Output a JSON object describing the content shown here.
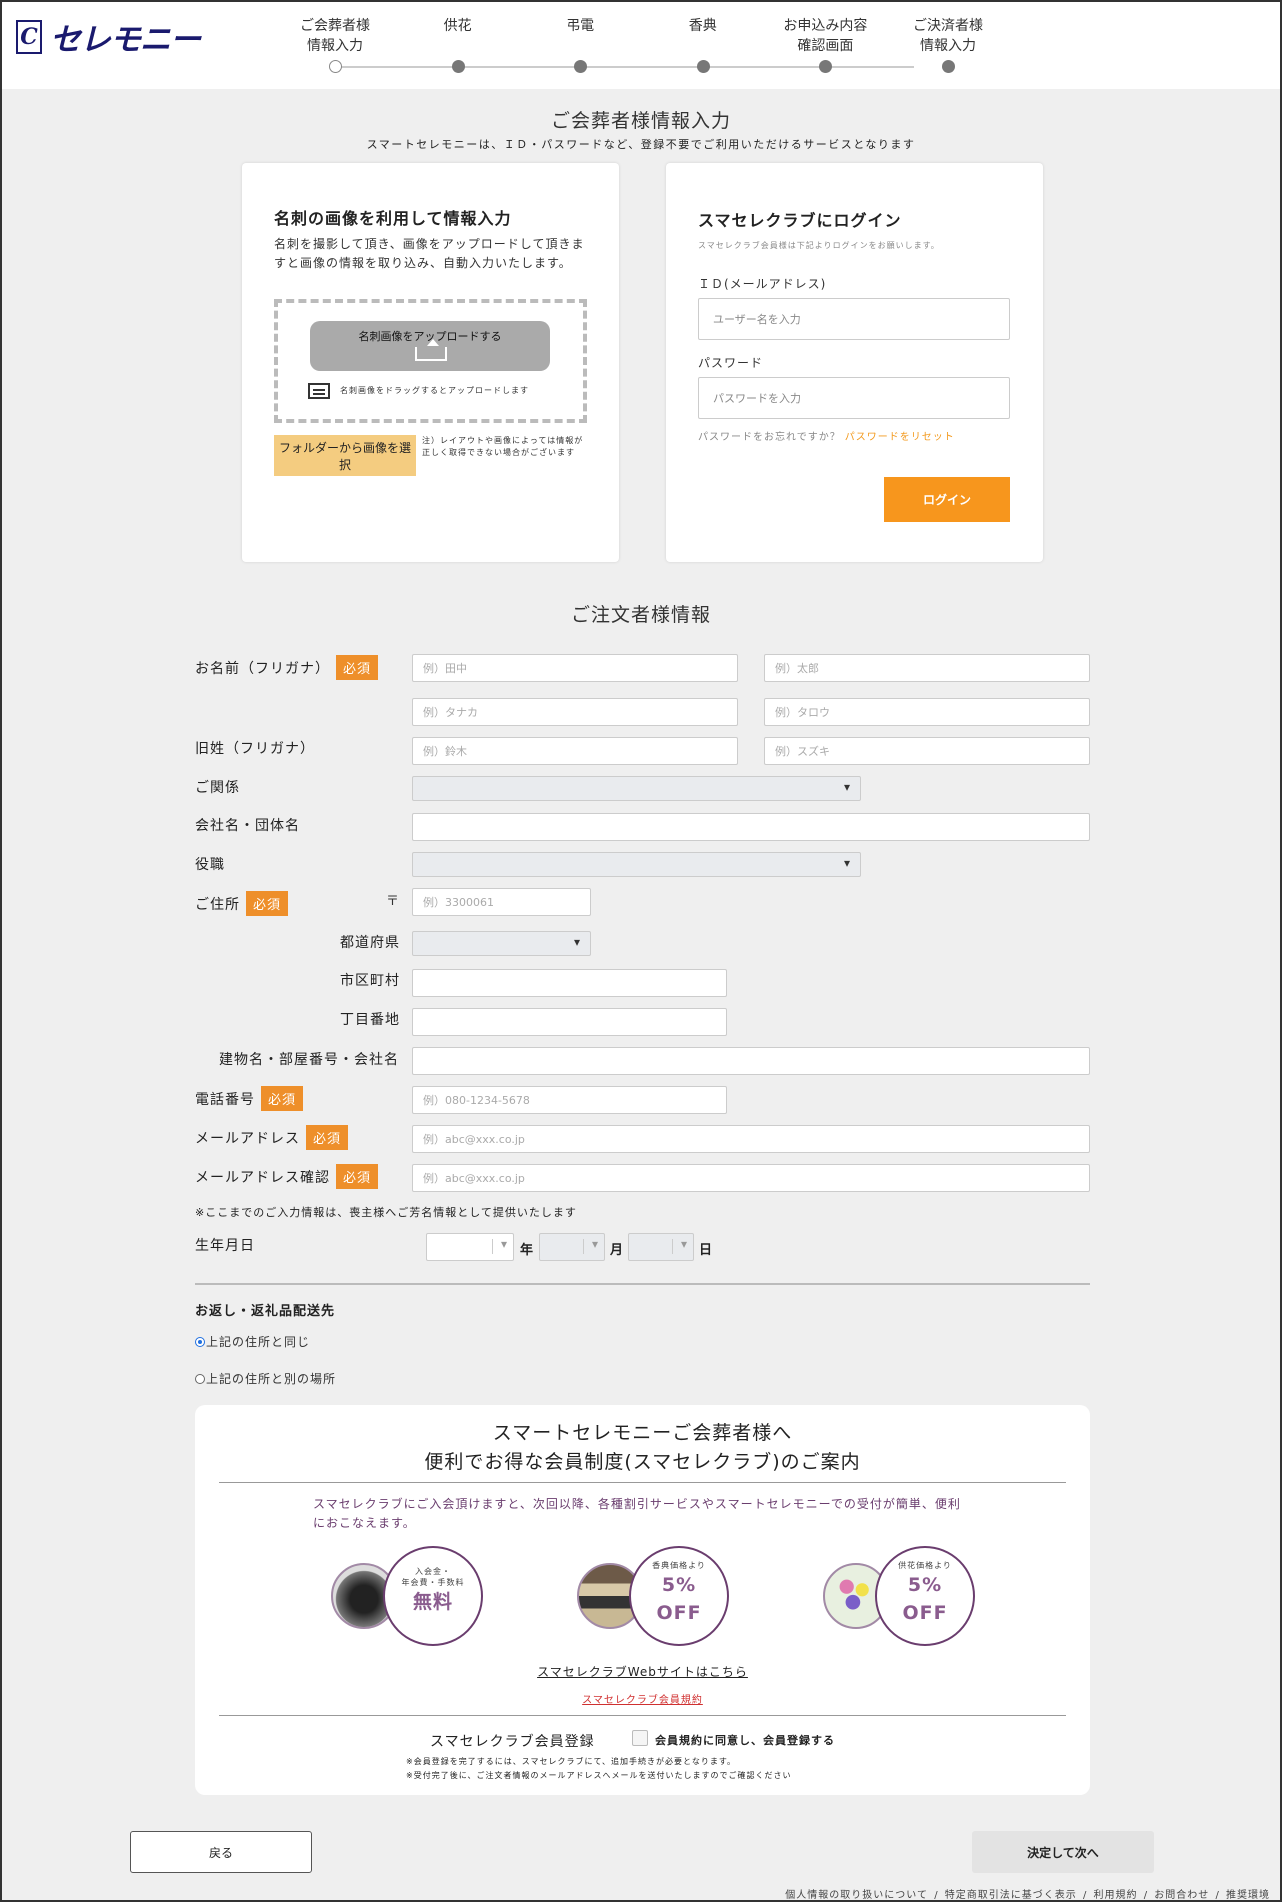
{
  "brand": {
    "logo_mark": "C",
    "logo_text": "セレモニー"
  },
  "steps": [
    {
      "label": "ご会葬者様\n情報入力",
      "current": true
    },
    {
      "label": "供花",
      "current": false
    },
    {
      "label": "弔電",
      "current": false
    },
    {
      "label": "香典",
      "current": false
    },
    {
      "label": "お申込み内容\n確認画面",
      "current": false
    },
    {
      "label": "ご決済者様\n情報入力",
      "current": false
    }
  ],
  "page": {
    "title": "ご会葬者様情報入力",
    "subtitle": "スマートセレモニーは、ＩＤ・パスワードなど、登録不要でご利用いただけるサービスとなります"
  },
  "card_upload": {
    "title": "名刺の画像を利用して情報入力",
    "description": "名刺を撮影して頂き、画像をアップロードして頂きますと画像の情報を取り込み、自動入力いたします。",
    "upload_button": "名刺画像をアップロードする",
    "drag_text": "名刺画像をドラッグするとアップロードします",
    "folder_button": "フォルダーから画像を選択",
    "note": "注）レイアウトや画像によっては情報が 正しく取得できない場合がございます"
  },
  "card_login": {
    "title": "スマセレクラブにログイン",
    "subtitle": "スマセレクラブ会員様は下記よりログインをお願いします。",
    "id_label": "ＩＤ(メールアドレス)",
    "id_placeholder": "ユーザー名を入力",
    "password_label": "パスワード",
    "password_placeholder": "パスワードを入力",
    "forgot_text": "パスワードをお忘れですか？",
    "reset_link": "パスワードをリセット",
    "login_button": "ログイン"
  },
  "order": {
    "title": "ご注文者様情報",
    "required": "必須",
    "name_label": "お名前（フリガナ）",
    "last_name_ph": "例）田中",
    "first_name_ph": "例）太郎",
    "last_kana_ph": "例）タナカ",
    "first_kana_ph": "例）タロウ",
    "maiden_label": "旧姓（フリガナ）",
    "maiden_last_ph": "例）鈴木",
    "maiden_kana_ph": "例）スズキ",
    "relation_label": "ご関係",
    "company_label": "会社名・団体名",
    "position_label": "役職",
    "address_label": "ご住所",
    "zip_mark": "〒",
    "zip_ph": "例）3300061",
    "prefecture_label": "都道府県",
    "city_label": "市区町村",
    "street_label": "丁目番地",
    "building_label": "建物名・部屋番号・会社名",
    "phone_label": "電話番号",
    "phone_ph": "例）080-1234-5678",
    "email_label": "メールアドレス",
    "email_ph": "例）abc@xxx.co.jp",
    "email_confirm_label": "メールアドレス確認",
    "email_confirm_ph": "例）abc@xxx.co.jp",
    "note": "※ここまでのご入力情報は、喪主様へご芳名情報として提供いたします",
    "dob_label": "生年月日",
    "dob_year": "年",
    "dob_month": "月",
    "dob_day": "日"
  },
  "shipping": {
    "title": "お返し・返礼品配送先",
    "option_same": "上記の住所と同じ",
    "option_other": "上記の住所と別の場所",
    "selected": "same"
  },
  "club": {
    "title": "スマートセレモニーご会葬者様へ\n便利でお得な会員制度(スマセレクラブ)のご案内",
    "description": "スマセレクラブにご入会頂けますと、次回以降、各種割引サービスやスマートセレモニーでの受付が簡単、便利におこなえます。",
    "benefits": [
      {
        "small": "入会金・\n年会費・手数料",
        "big": "無料"
      },
      {
        "small": "香典価格より",
        "big": "5%\nOFF"
      },
      {
        "small": "供花価格より",
        "big": "5%\nOFF"
      }
    ],
    "site_link": "スマセレクラブWebサイトはこちら",
    "terms_link": "スマセレクラブ会員規約",
    "register_label": "スマセレクラブ会員登録",
    "agree_label": "会員規約に同意し、会員登録する",
    "note1": "※会員登録を完了するには、スマセレクラブにて、追加手続きが必要となります。",
    "note2": "※受付完了後に、ご注文者情報のメールアドレスへメールを送付いたしますのでご確認ください"
  },
  "nav": {
    "back": "戻る",
    "next": "決定して次へ"
  },
  "footer": {
    "links": [
      "個人情報の取り扱いについて",
      "特定商取引法に基づく表示",
      "利用規約",
      "お問合わせ",
      "推奨環境"
    ],
    "separator": "/"
  },
  "colors": {
    "accent": "#f7961d",
    "brand": "#1a1a6e",
    "club": "#6a3d6e",
    "badge": "#ee8f2a"
  }
}
